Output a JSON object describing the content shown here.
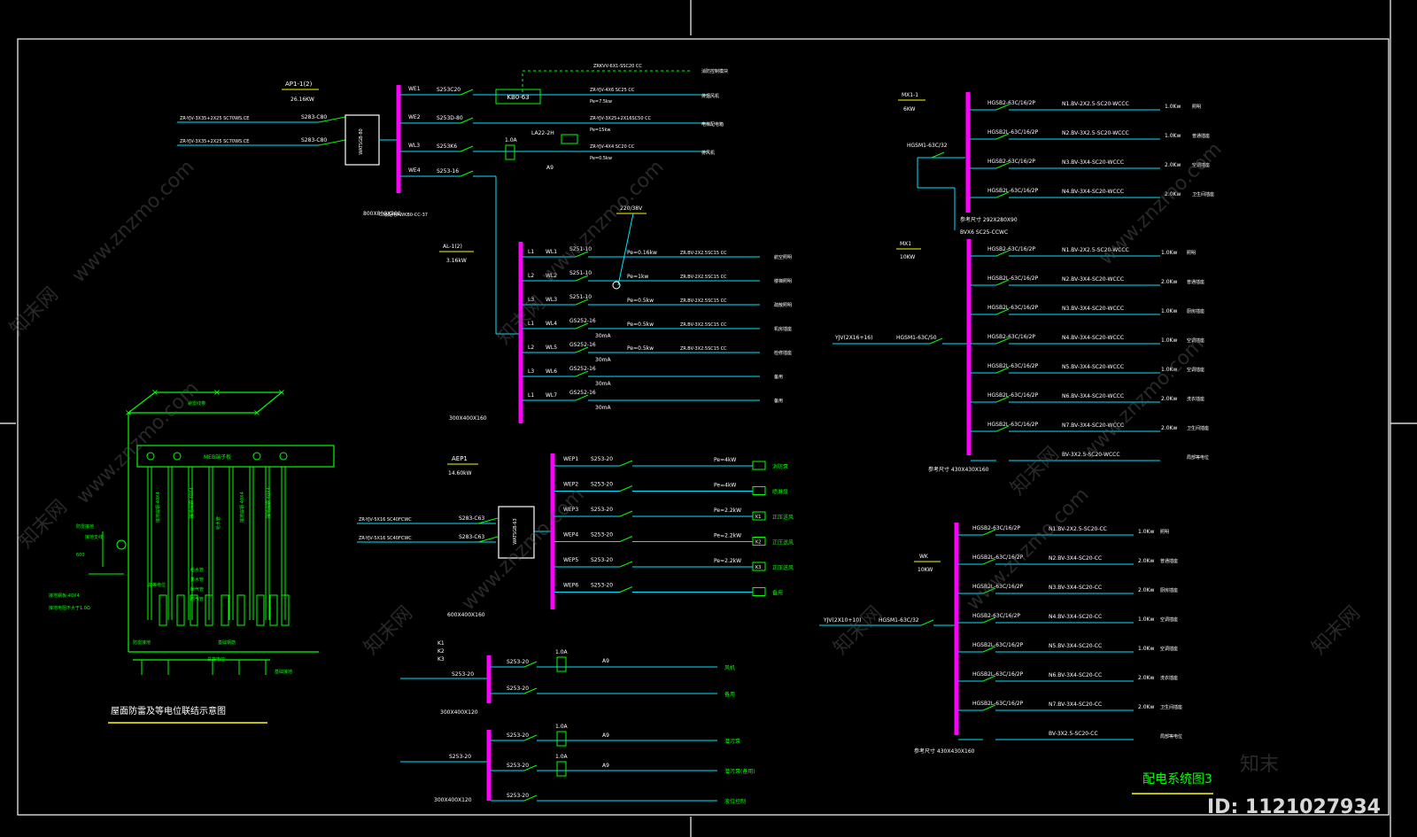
{
  "colors": {
    "background": "#000000",
    "frame": "#ffffff",
    "wire": "#00e5ff",
    "busbar": "#ff00ff",
    "label_yellow": "#ffff00",
    "label_green": "#00ff00",
    "label_white": "#ffffff"
  },
  "panels": [
    {
      "id": "ap1",
      "name": "AP1-1(2)",
      "power": "26.16KW",
      "box": "800X800X200",
      "feeds": [
        "ZR-YJV-3X35+2X25 SC70WS.CE",
        "ZR-YJV-3X35+2X25 SC70WS.CE"
      ],
      "mains": [
        "S283-C80",
        "S283-C80"
      ],
      "ats": "WATSGB-80",
      "bus_note": "二级配电AWKB0-CC-37",
      "circuits": [
        {
          "id": "WE1",
          "breaker": "S253C20",
          "device": "KB0-63",
          "cable": "ZR-YJV-4X6 SC25 CC",
          "pe": "Pe=7.5kw",
          "load": "排烟风机"
        },
        {
          "id": "WE2",
          "breaker": "S253D-80",
          "device": "",
          "cable": "ZR-YJV-3X25+2X16SC50 CC",
          "pe": "Pe=15kw",
          "load": "电梯配电箱"
        },
        {
          "id": "WL3",
          "breaker": "S253K6",
          "device": "LA22-2H",
          "cable": "ZR-YJV-4X4 SC20 CC",
          "pe": "Pe=0.5kw",
          "load": "排风机"
        },
        {
          "id": "WE4",
          "breaker": "S253-16",
          "device": "",
          "cable": "",
          "pe": "",
          "load": ""
        }
      ],
      "top_link": {
        "cable": "ZRKVV-6X1-SSC20 CC",
        "load": "消防控制模块"
      },
      "relay": "1.0A",
      "relay2": "A9"
    },
    {
      "id": "al",
      "name": "AL-1(2)",
      "power": "3.16kW",
      "voltage": "220/38V",
      "box": "300X400X160",
      "circuits": [
        {
          "ph": "L1",
          "id": "WL1",
          "breaker": "S251-10",
          "pe": "Pe=0.16kw",
          "cable": "ZR.BV-2X2.5SC15 CC",
          "load": "航空照明"
        },
        {
          "ph": "L2",
          "id": "WL2",
          "breaker": "S251-10",
          "pe": "Pe=1kw",
          "cable": "ZR.BV-2X2.5SC15 CC",
          "load": "楼梯照明"
        },
        {
          "ph": "L3",
          "id": "WL3",
          "breaker": "S251-10",
          "pe": "Pe=0.5kw",
          "cable": "ZR.BV-2X2.5SC15 CC",
          "load": "疏散照明"
        },
        {
          "ph": "L1",
          "id": "WL4",
          "breaker": "GS252-16",
          "pe": "Pe=0.5kw",
          "cable": "ZR.BV-3X2.5SC15 CC",
          "load": "机房插座",
          "rcd": "30mA"
        },
        {
          "ph": "L2",
          "id": "WL5",
          "breaker": "GS252-16",
          "pe": "Pe=0.5kw",
          "cable": "ZR.BV-3X2.5SC15 CC",
          "load": "检修插座",
          "rcd": "30mA"
        },
        {
          "ph": "L3",
          "id": "WL6",
          "breaker": "GS252-16",
          "pe": "",
          "cable": "",
          "load": "备用",
          "rcd": "30mA"
        },
        {
          "ph": "L1",
          "id": "WL7",
          "breaker": "GS252-16",
          "pe": "",
          "cable": "",
          "load": "备用",
          "rcd": "30mA"
        }
      ]
    },
    {
      "id": "aep1",
      "name": "AEP1",
      "power": "14.60kW",
      "box": "600X400X160",
      "feeds": [
        "ZR-YJV-5X16 SC40FCWC",
        "ZR-YJV-5X16 SC40FCWC"
      ],
      "mains": [
        "S283-C63",
        "S283-C63"
      ],
      "ats": "WATSGB-63",
      "circuits": [
        {
          "id": "WEP1",
          "breaker": "S253-20",
          "pe": "Pe=4kW",
          "load": "消防泵",
          "tag": ""
        },
        {
          "id": "WEP2",
          "breaker": "S253-20",
          "pe": "Pe=4kW",
          "load": "喷淋泵",
          "tag": ""
        },
        {
          "id": "WEP3",
          "breaker": "S253-20",
          "pe": "Pe=2.2kW",
          "load": "正压送风",
          "tag": "K1"
        },
        {
          "id": "WEP4",
          "breaker": "S253-20",
          "pe": "Pe=2.2kW",
          "load": "正压送风",
          "tag": "K2"
        },
        {
          "id": "WEP5",
          "breaker": "S253-20",
          "pe": "Pe=2.2kW",
          "load": "正压送风",
          "tag": "K3"
        },
        {
          "id": "WEP6",
          "breaker": "S253-20",
          "pe": "",
          "load": "备用",
          "tag": ""
        }
      ]
    },
    {
      "id": "k",
      "name": "K1\nK2\nK3",
      "box": "300X400X120",
      "circuits": [
        {
          "breaker": "S253-20",
          "breaker2": "S253-20",
          "relay": "1.0A",
          "relay2": "A9",
          "load": "风机"
        },
        {
          "breaker": "S253-20",
          "load": "备用"
        }
      ]
    },
    {
      "id": "pump",
      "box": "300X400X120",
      "circuits": [
        {
          "breaker": "S253-20",
          "relay": "1.0A",
          "relay2": "A9",
          "load": "潜污泵"
        },
        {
          "breaker": "S253-20",
          "relay": "1.0A",
          "relay2": "A9",
          "load": "潜污泵(备用)"
        },
        {
          "breaker": "S253-20",
          "load": "液位控制"
        }
      ],
      "main": "S253-20"
    },
    {
      "id": "mx1",
      "name": "MX1-1",
      "power": "6KW",
      "main": "HGSM1-63C/32",
      "box": "参考尺寸 292X280X90",
      "feed": "BVX6 SC25-CCWC",
      "circuits": [
        {
          "breaker": "HGSB2-63C/16/2P",
          "cable": "N1.BV-2X2.5-SC20-WCCC",
          "kw": "1.0Kw",
          "load": "照明"
        },
        {
          "breaker": "HGSB2L-63C/16/2P",
          "cable": "N2.BV-3X2.5-SC20-WCCC",
          "kw": "1.0Kw",
          "load": "普通插座"
        },
        {
          "breaker": "HGSB2-63C/16/2P",
          "cable": "N3.BV-3X4-SC20-WCCC",
          "kw": "2.0Kw",
          "load": "空调插座"
        },
        {
          "breaker": "HGSB2L-63C/16/2P",
          "cable": "N4.BV-3X4-SC20-WCCC",
          "kw": "2.0Kw",
          "load": "卫生间插座"
        }
      ]
    },
    {
      "id": "mx",
      "name": "MX1",
      "power": "10KW",
      "feed": "YJV(2X16+16)",
      "main": "HGSM1-63C/50",
      "box": "参考尺寸 430X430X160",
      "circuits": [
        {
          "breaker": "HGSB2-63C/16/2P",
          "cable": "N1.BV-2X2.5-SC20-WCCC",
          "kw": "1.0Kw",
          "load": "照明"
        },
        {
          "breaker": "HGSB2L-63C/16/2P",
          "cable": "N2.BV-3X4-SC20-WCCC",
          "kw": "2.0Kw",
          "load": "普通插座"
        },
        {
          "breaker": "HGSB2L-63C/16/2P",
          "cable": "N3.BV-3X4-SC20-WCCC",
          "kw": "1.0Kw",
          "load": "厨房插座"
        },
        {
          "breaker": "HGSB2-63C/16/2P",
          "cable": "N4.BV-3X4-SC20-WCCC",
          "kw": "1.0Kw",
          "load": "空调插座"
        },
        {
          "breaker": "HGSB2L-63C/16/2P",
          "cable": "N5.BV-3X4-SC20-WCCC",
          "kw": "1.0Kw",
          "load": "空调插座"
        },
        {
          "breaker": "HGSB2L-63C/16/2P",
          "cable": "N6.BV-3X4-SC20-WCCC",
          "kw": "2.0Kw",
          "load": "洗衣插座"
        },
        {
          "breaker": "HGSB2L-63C/16/2P",
          "cable": "N7.BV-3X4-SC20-WCCC",
          "kw": "2.0Kw",
          "load": "卫生间插座"
        },
        {
          "breaker": "",
          "cable": "BV-3X2.5-SC20-WCCC",
          "kw": "",
          "load": "局部等电位"
        }
      ]
    },
    {
      "id": "wk",
      "name": "WK",
      "power": "10KW",
      "feed": "YJV(2X10+10)",
      "main": "HGSM1-63C/32",
      "box": "参考尺寸 430X430X160",
      "circuits": [
        {
          "breaker": "HGSB2-63C/16/2P",
          "cable": "N1.BV-2X2.5-SC20-CC",
          "kw": "1.0Kw",
          "load": "照明"
        },
        {
          "breaker": "HGSB2L-63C/16/2P",
          "cable": "N2.BV-3X4-SC20-CC",
          "kw": "2.0Kw",
          "load": "普通插座"
        },
        {
          "breaker": "HGSB2L-63C/16/2P",
          "cable": "N3.BV-3X4-SC20-CC",
          "kw": "2.0Kw",
          "load": "厨房插座"
        },
        {
          "breaker": "HGSB2-63C/16/2P",
          "cable": "N4.BV-3X4-SC20-CC",
          "kw": "1.0Kw",
          "load": "空调插座"
        },
        {
          "breaker": "HGSB2L-63C/16/2P",
          "cable": "N5.BV-3X4-SC20-CC",
          "kw": "1.0Kw",
          "load": "空调插座"
        },
        {
          "breaker": "HGSB2L-63C/16/2P",
          "cable": "N6.BV-3X4-SC20-CC",
          "kw": "2.0Kw",
          "load": "洗衣插座"
        },
        {
          "breaker": "HGSB2L-63C/16/2P",
          "cable": "N7.BV-3X4-SC20-CC",
          "kw": "2.0Kw",
          "load": "卫生间插座"
        },
        {
          "breaker": "",
          "cable": "BV-3X2.5-SC20-CC",
          "kw": "",
          "load": "局部等电位"
        }
      ]
    }
  ],
  "lightning": {
    "title": "屋面防雷及等电位联结示意图",
    "labels": [
      "避雷线带",
      "MEB端子板",
      "接地引下线",
      "等电位连接",
      "卫生间插座",
      "防雷接地",
      "基础钢筋",
      "接地扁钢-40X4",
      "接地扁钢-40X4",
      "接地扁钢-40X4",
      "接地扁钢-40X4",
      "接地扁钢-40X4",
      "给水管",
      "排水管",
      "暖气管",
      "燃气管",
      "进户线",
      "接地引下线",
      "总等电位",
      "基础接地"
    ],
    "side_labels": [
      "防雷接地",
      "接地支线",
      "600",
      "接地钢板-40X4",
      "接地电阻不大于1.0Ω"
    ]
  },
  "drawing_title": "配电系统图3",
  "watermark": {
    "brand": "知末",
    "id": "ID: 1121027934",
    "site": "www.znzmo.com",
    "site_cn": "知末网"
  }
}
